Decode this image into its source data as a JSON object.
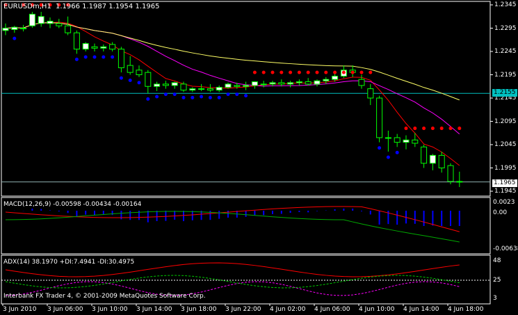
{
  "main_panel": {
    "symbol_label": "EURUSDm,H1",
    "ohlc": "1.1966 1.1987 1.1954 1.1965",
    "price_ticks": [
      "1.2345",
      "1.2295",
      "1.2245",
      "1.2195",
      "1.2145",
      "1.2095",
      "1.2045",
      "1.1995",
      "1.1945"
    ],
    "hline_label": "1.2155",
    "current_price_label": "1.1965",
    "colors": {
      "bull": "#00ff00",
      "bear": "#00ff00",
      "bull_fill": "#ffffff",
      "psar_up": "#0000ff",
      "psar_down": "#ff0000",
      "ma_fast": "#ff0000",
      "ma_mid": "#ff00ff",
      "ma_slow": "#ffff66",
      "hline": "#00c0c0"
    }
  },
  "macd_panel": {
    "label": "MACD(12,26,9) -0.00598 -0.00434 -0.00164",
    "ticks": [
      "0.0023",
      "0.00",
      "-0.00638"
    ]
  },
  "adx_panel": {
    "label": "ADX(14) 38.1970 +DI:7.4941 -DI:30.4975",
    "ticks": [
      "48",
      "25",
      "3"
    ],
    "watermark": "Interbank FX Trader 4, © 2001-2009 MetaQuotes Software Corp."
  },
  "time_axis": [
    "3 Jun 2010",
    "3 Jun 06:00",
    "3 Jun 10:00",
    "3 Jun 14:00",
    "3 Jun 18:00",
    "3 Jun 22:00",
    "4 Jun 02:00",
    "4 Jun 06:00",
    "4 Jun 10:00",
    "4 Jun 14:00",
    "4 Jun 18:00"
  ],
  "chart_data": {
    "type": "candlestick",
    "symbol": "EURUSDm",
    "timeframe": "H1",
    "candles": [
      {
        "o": 1.229,
        "h": 1.2305,
        "l": 1.228,
        "c": 1.2295
      },
      {
        "o": 1.2292,
        "h": 1.23,
        "l": 1.2285,
        "c": 1.2297
      },
      {
        "o": 1.2295,
        "h": 1.2302,
        "l": 1.2288,
        "c": 1.2294
      },
      {
        "o": 1.23,
        "h": 1.233,
        "l": 1.2296,
        "c": 1.2325
      },
      {
        "o": 1.2305,
        "h": 1.233,
        "l": 1.2298,
        "c": 1.232
      },
      {
        "o": 1.2305,
        "h": 1.2318,
        "l": 1.2295,
        "c": 1.231
      },
      {
        "o": 1.2305,
        "h": 1.2315,
        "l": 1.2295,
        "c": 1.23
      },
      {
        "o": 1.23,
        "h": 1.232,
        "l": 1.228,
        "c": 1.2285
      },
      {
        "o": 1.2285,
        "h": 1.229,
        "l": 1.224,
        "c": 1.225
      },
      {
        "o": 1.225,
        "h": 1.2265,
        "l": 1.2245,
        "c": 1.2262
      },
      {
        "o": 1.2255,
        "h": 1.2262,
        "l": 1.2245,
        "c": 1.2252
      },
      {
        "o": 1.2252,
        "h": 1.226,
        "l": 1.2245,
        "c": 1.2255
      },
      {
        "o": 1.226,
        "h": 1.2265,
        "l": 1.2245,
        "c": 1.225
      },
      {
        "o": 1.225,
        "h": 1.2255,
        "l": 1.22,
        "c": 1.221
      },
      {
        "o": 1.2215,
        "h": 1.2235,
        "l": 1.2195,
        "c": 1.22
      },
      {
        "o": 1.2205,
        "h": 1.2215,
        "l": 1.219,
        "c": 1.2195
      },
      {
        "o": 1.22,
        "h": 1.2205,
        "l": 1.2155,
        "c": 1.217
      },
      {
        "o": 1.217,
        "h": 1.218,
        "l": 1.216,
        "c": 1.2175
      },
      {
        "o": 1.2175,
        "h": 1.2182,
        "l": 1.2165,
        "c": 1.2172
      },
      {
        "o": 1.2172,
        "h": 1.218,
        "l": 1.2165,
        "c": 1.2178
      },
      {
        "o": 1.2175,
        "h": 1.218,
        "l": 1.2158,
        "c": 1.2162
      },
      {
        "o": 1.2162,
        "h": 1.2168,
        "l": 1.2158,
        "c": 1.2165
      },
      {
        "o": 1.2165,
        "h": 1.2175,
        "l": 1.216,
        "c": 1.2165
      },
      {
        "o": 1.2165,
        "h": 1.2175,
        "l": 1.2158,
        "c": 1.2162
      },
      {
        "o": 1.2162,
        "h": 1.2172,
        "l": 1.2158,
        "c": 1.2168
      },
      {
        "o": 1.2168,
        "h": 1.2178,
        "l": 1.2165,
        "c": 1.2175
      },
      {
        "o": 1.2172,
        "h": 1.2178,
        "l": 1.2165,
        "c": 1.217
      },
      {
        "o": 1.217,
        "h": 1.218,
        "l": 1.2162,
        "c": 1.2172
      },
      {
        "o": 1.2172,
        "h": 1.218,
        "l": 1.2165,
        "c": 1.218
      },
      {
        "o": 1.2175,
        "h": 1.2182,
        "l": 1.2168,
        "c": 1.2175
      },
      {
        "o": 1.2175,
        "h": 1.2182,
        "l": 1.217,
        "c": 1.2178
      },
      {
        "o": 1.2178,
        "h": 1.2185,
        "l": 1.217,
        "c": 1.2175
      },
      {
        "o": 1.2175,
        "h": 1.2182,
        "l": 1.2168,
        "c": 1.2178
      },
      {
        "o": 1.2178,
        "h": 1.2185,
        "l": 1.2172,
        "c": 1.218
      },
      {
        "o": 1.218,
        "h": 1.2188,
        "l": 1.2172,
        "c": 1.2175
      },
      {
        "o": 1.2175,
        "h": 1.2185,
        "l": 1.217,
        "c": 1.2182
      },
      {
        "o": 1.2182,
        "h": 1.219,
        "l": 1.2175,
        "c": 1.2185
      },
      {
        "o": 1.2185,
        "h": 1.22,
        "l": 1.218,
        "c": 1.2192
      },
      {
        "o": 1.2192,
        "h": 1.2215,
        "l": 1.2188,
        "c": 1.2205
      },
      {
        "o": 1.2205,
        "h": 1.2215,
        "l": 1.219,
        "c": 1.22
      },
      {
        "o": 1.2185,
        "h": 1.2195,
        "l": 1.2165,
        "c": 1.2172
      },
      {
        "o": 1.2165,
        "h": 1.2175,
        "l": 1.213,
        "c": 1.2145
      },
      {
        "o": 1.2145,
        "h": 1.215,
        "l": 1.205,
        "c": 1.206
      },
      {
        "o": 1.206,
        "h": 1.2075,
        "l": 1.203,
        "c": 1.206
      },
      {
        "o": 1.206,
        "h": 1.2068,
        "l": 1.204,
        "c": 1.205
      },
      {
        "o": 1.205,
        "h": 1.2065,
        "l": 1.2035,
        "c": 1.2055
      },
      {
        "o": 1.2055,
        "h": 1.207,
        "l": 1.204,
        "c": 1.2048
      },
      {
        "o": 1.204,
        "h": 1.2045,
        "l": 1.1995,
        "c": 1.2005
      },
      {
        "o": 1.2005,
        "h": 1.2025,
        "l": 1.199,
        "c": 1.2022
      },
      {
        "o": 1.2022,
        "h": 1.203,
        "l": 1.1985,
        "c": 1.1995
      },
      {
        "o": 1.2,
        "h": 1.2005,
        "l": 1.196,
        "c": 1.1966
      },
      {
        "o": 1.1966,
        "h": 1.1987,
        "l": 1.1954,
        "c": 1.1965
      }
    ]
  }
}
